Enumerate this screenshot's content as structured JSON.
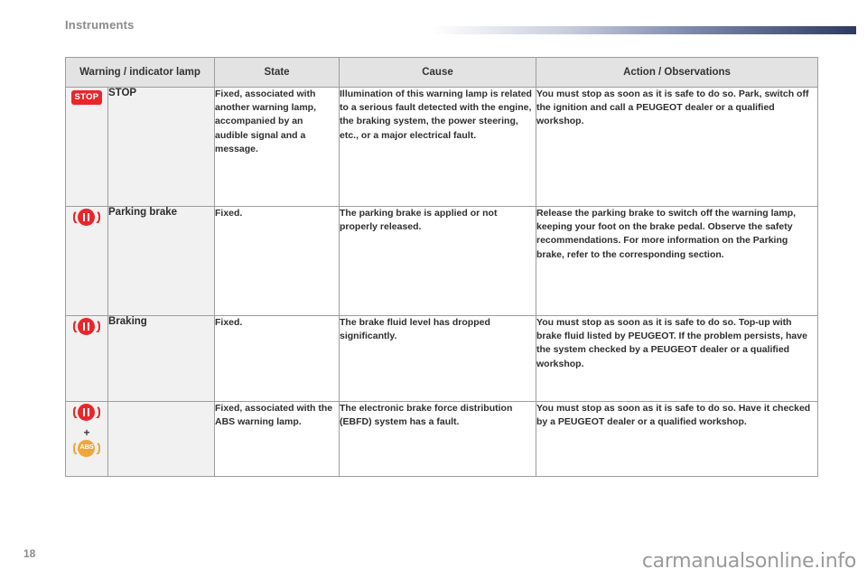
{
  "header": {
    "section_title": "Instruments",
    "rule_gradient_from": "#ffffff",
    "rule_gradient_to": "#2d3a63"
  },
  "table": {
    "columns": [
      {
        "key": "lamp",
        "label": "Warning / indicator lamp"
      },
      {
        "key": "state",
        "label": "State"
      },
      {
        "key": "cause",
        "label": "Cause"
      },
      {
        "key": "action",
        "label": "Action / Observations"
      }
    ],
    "rows": [
      {
        "icon": {
          "type": "stop-badge",
          "text": "STOP",
          "color": "#e8262b"
        },
        "name": "STOP",
        "state": "Fixed, associated with another warning lamp, accompanied by an audible signal and a message.",
        "cause": "Illumination of this warning lamp is related to a serious fault detected with the engine, the braking system, the power steering, etc., or a major electrical fault.",
        "action": "You must stop as soon as it is safe to do so. Park, switch off the ignition and call a PEUGEOT dealer or a qualified workshop."
      },
      {
        "icon": {
          "type": "parking-brake-lamp",
          "color": "#e8262b"
        },
        "name": "Parking brake",
        "state": "Fixed.",
        "cause": "The parking brake is applied or not properly released.",
        "action": "Release the parking brake to switch off the warning lamp, keeping your foot on the brake pedal. Observe the safety recommendations. For more information on the Parking brake, refer to the corresponding section."
      },
      {
        "icon": {
          "type": "braking-lamp",
          "color": "#e8262b"
        },
        "name": "Braking",
        "state": "Fixed.",
        "cause": "The brake fluid level has dropped significantly.",
        "action": "You must stop as soon as it is safe to do so. Top-up with brake fluid listed by PEUGEOT. If the problem persists, have the system checked by a PEUGEOT dealer or a qualified workshop."
      },
      {
        "icon": {
          "type": "braking-plus-abs",
          "plus": "+",
          "color_top": "#e8262b",
          "color_bottom": "#f0a63a",
          "abs_label": "ABS"
        },
        "name": "",
        "state": "Fixed, associated with the ABS warning lamp.",
        "cause": "The electronic brake force distribution (EBFD) system has a fault.",
        "action": "You must stop as soon as it is safe to do so. Have it checked by a PEUGEOT dealer or a qualified workshop."
      }
    ]
  },
  "footer": {
    "page_number": "18",
    "watermark": "carmanualsonline.info"
  }
}
